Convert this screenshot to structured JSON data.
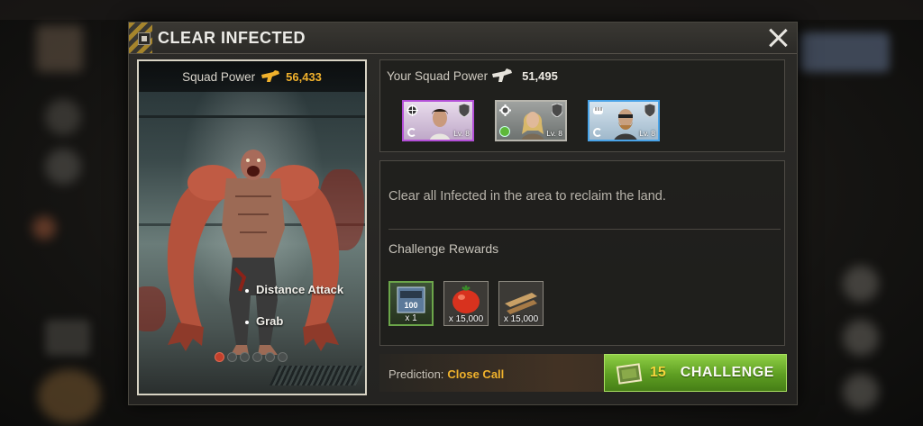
{
  "modal": {
    "title": "CLEAR INFECTED",
    "close_icon": "close-icon"
  },
  "enemy": {
    "squad_power_label": "Squad Power",
    "squad_power_value": "56,433",
    "abilities": [
      "Distance Attack",
      "Grab"
    ],
    "pager": {
      "total": 6,
      "active_index": 0
    }
  },
  "your_squad": {
    "label": "Your Squad Power",
    "value": "51,495",
    "heroes": [
      {
        "level": "Lv. 8",
        "rarity_color": "#b450d8",
        "role_icon": "crosshair-icon"
      },
      {
        "level": "Lv. 8",
        "rarity_color": "#b8b6ae",
        "role_icon": "gear-icon"
      },
      {
        "level": "Lv. 8",
        "rarity_color": "#4aa4e8",
        "role_icon": "fist-icon"
      }
    ]
  },
  "info": {
    "description": "Clear all Infected in the area to reclaim the land.",
    "rewards_title": "Challenge Rewards",
    "rewards": [
      {
        "icon": "exp-book-icon",
        "badge": "100",
        "quantity": "x 1"
      },
      {
        "icon": "tomato-icon",
        "quantity": "x 15,000"
      },
      {
        "icon": "wood-planks-icon",
        "quantity": "x 15,000"
      }
    ]
  },
  "prediction": {
    "label": "Prediction:",
    "value": "Close Call",
    "value_color": "#f0b22c"
  },
  "challenge": {
    "cost": "15",
    "label": "CHALLENGE",
    "button_color": "#5e9e22"
  }
}
